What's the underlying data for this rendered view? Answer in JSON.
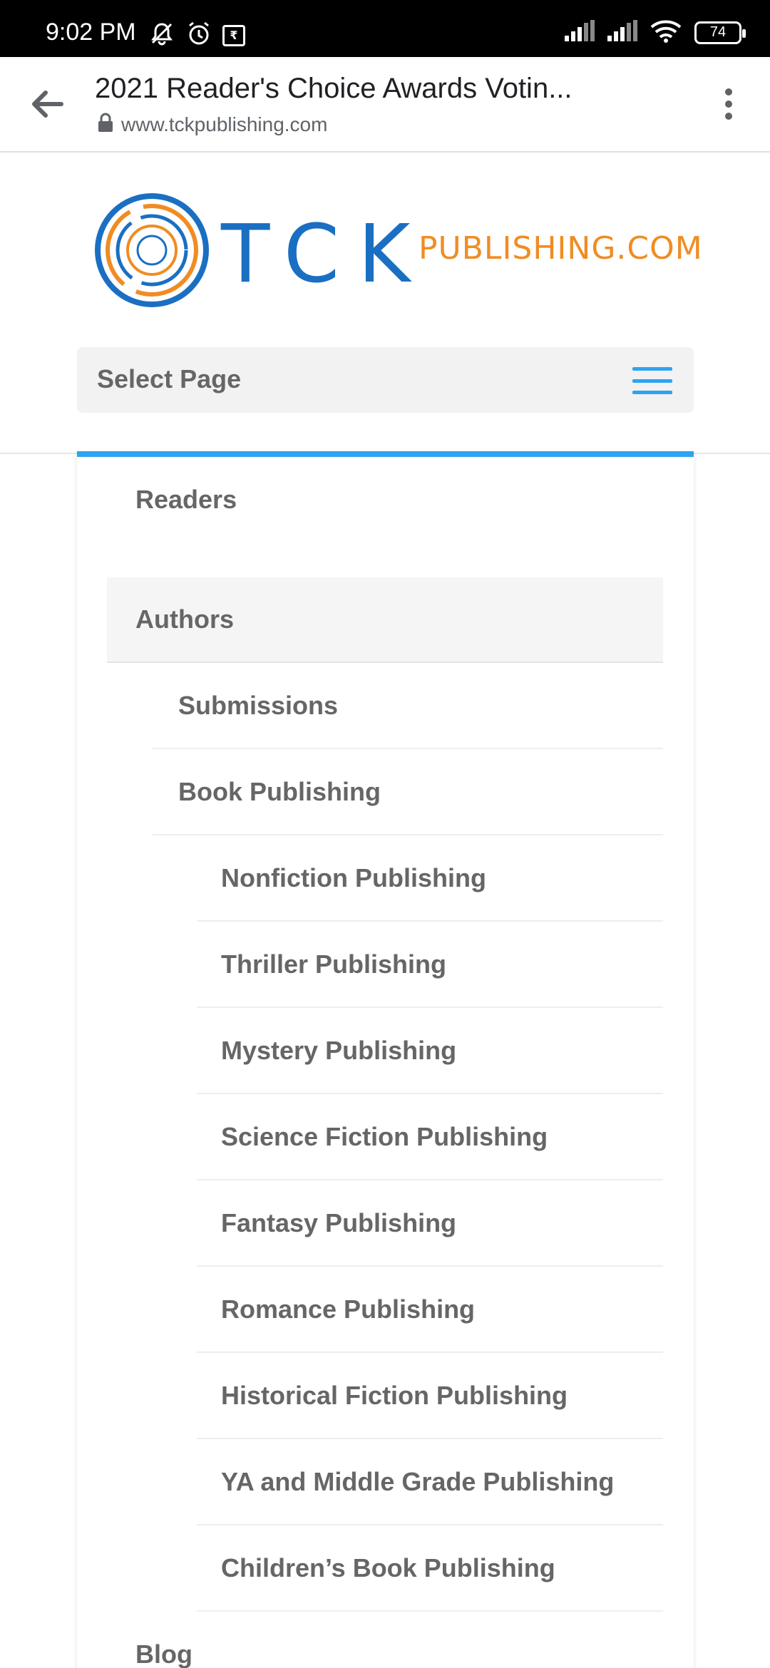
{
  "status_bar": {
    "time": "9:02 PM",
    "battery": "74",
    "icons": [
      "mute-bell-icon",
      "alarm-icon",
      "rupee-box-icon",
      "signal-icon",
      "signal-icon",
      "wifi-icon",
      "battery-icon"
    ]
  },
  "browser": {
    "title": "2021 Reader's Choice Awards Votin...",
    "url": "www.tckpublishing.com"
  },
  "site": {
    "logo_main": "TCK",
    "logo_sub": "PUBLISHING.COM",
    "select_page": "Select Page"
  },
  "menu": {
    "readers": "Readers",
    "authors": "Authors",
    "submissions": "Submissions",
    "book_publishing": "Book Publishing",
    "nonfiction": "Nonfiction Publishing",
    "thriller": "Thriller Publishing",
    "mystery": "Mystery Publishing",
    "scifi": "Science Fiction Publishing",
    "fantasy": "Fantasy Publishing",
    "romance": "Romance Publishing",
    "historical": "Historical Fiction Publishing",
    "ya": "YA and Middle Grade Publishing",
    "childrens": "Children’s Book Publishing",
    "blog": "Blog"
  },
  "colors": {
    "accent": "#2ea3f2",
    "logo_blue": "#1b6fc2",
    "logo_orange": "#f08c23",
    "menu_text": "#666666"
  }
}
